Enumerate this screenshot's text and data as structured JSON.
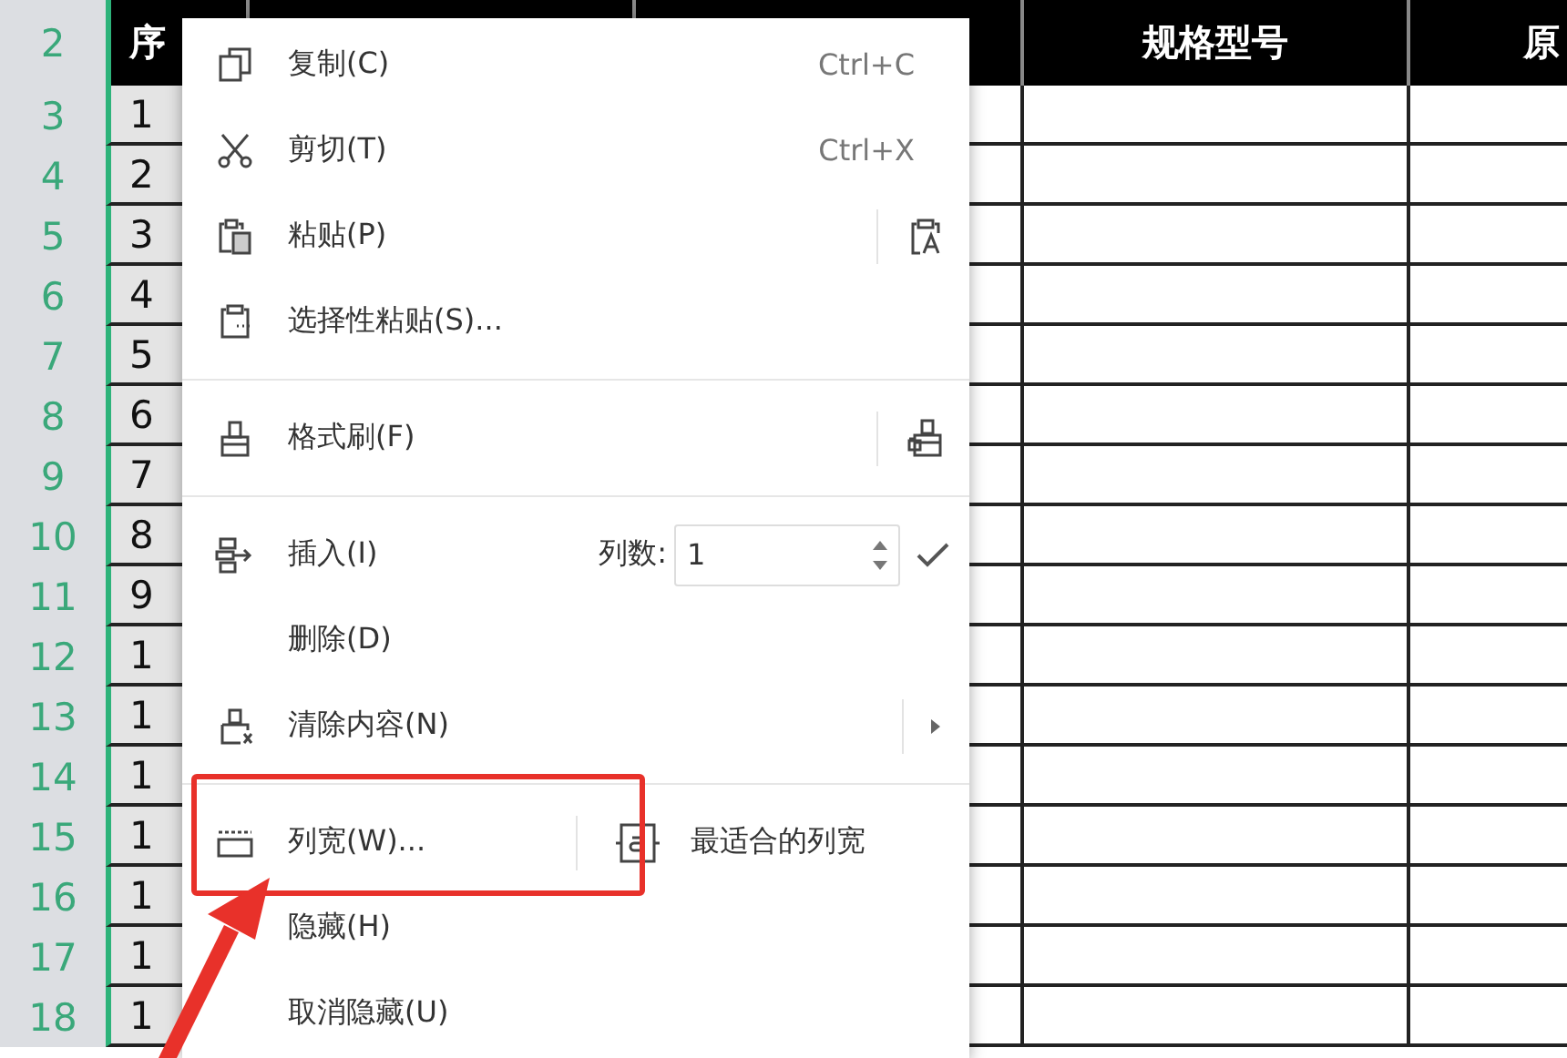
{
  "sheet": {
    "header_row": "2",
    "columns": [
      {
        "header": "序",
        "selected": true
      },
      {
        "selected": false
      },
      {
        "selected": false
      },
      {
        "header": "规格型号",
        "selected": false
      },
      {
        "header": "原",
        "selected": false
      }
    ],
    "rows": [
      {
        "number": "3",
        "serial": "1"
      },
      {
        "number": "4",
        "serial": "2"
      },
      {
        "number": "5",
        "serial": "3"
      },
      {
        "number": "6",
        "serial": "4"
      },
      {
        "number": "7",
        "serial": "5"
      },
      {
        "number": "8",
        "serial": "6"
      },
      {
        "number": "9",
        "serial": "7"
      },
      {
        "number": "10",
        "serial": "8"
      },
      {
        "number": "11",
        "serial": "9"
      },
      {
        "number": "12",
        "serial": "1"
      },
      {
        "number": "13",
        "serial": "1"
      },
      {
        "number": "14",
        "serial": "1"
      },
      {
        "number": "15",
        "serial": "1"
      },
      {
        "number": "16",
        "serial": "1"
      },
      {
        "number": "17",
        "serial": "1"
      },
      {
        "number": "18",
        "serial": "1"
      }
    ]
  },
  "menu": {
    "items": [
      {
        "kind": "copy",
        "label": "复制(C)",
        "highlighted": false,
        "trailing": {
          "kind": "shortcut",
          "text": "Ctrl+C"
        }
      },
      {
        "kind": "cut",
        "label": "剪切(T)",
        "highlighted": false,
        "trailing": {
          "kind": "shortcut",
          "text": "Ctrl+X"
        }
      },
      {
        "kind": "paste",
        "label": "粘贴(P)",
        "highlighted": false,
        "trailing": {
          "kind": "paste-format"
        }
      },
      {
        "kind": "paste-special",
        "label": "选择性粘贴(S)...",
        "highlighted": false
      },
      {
        "kind": "divider"
      },
      {
        "kind": "format-painter",
        "label": "格式刷(F)",
        "highlighted": false,
        "trailing": {
          "kind": "format-painter"
        }
      },
      {
        "kind": "divider"
      },
      {
        "kind": "insert",
        "label": "插入(I)",
        "highlighted": false,
        "trailing": {
          "kind": "count",
          "label": "列数:",
          "value": "1"
        }
      },
      {
        "kind": "delete",
        "label": "删除(D)",
        "highlighted": false
      },
      {
        "kind": "clear",
        "label": "清除内容(N)",
        "highlighted": false,
        "trailing": {
          "kind": "submenu"
        }
      },
      {
        "kind": "divider"
      },
      {
        "kind": "column-width",
        "label": "列宽(W)...",
        "highlighted": true,
        "trailing": {
          "kind": "autofit",
          "label": "最适合的列宽"
        }
      },
      {
        "kind": "hide",
        "label": "隐藏(H)",
        "highlighted": false
      },
      {
        "kind": "unhide",
        "label": "取消隐藏(U)",
        "highlighted": false
      }
    ]
  }
}
